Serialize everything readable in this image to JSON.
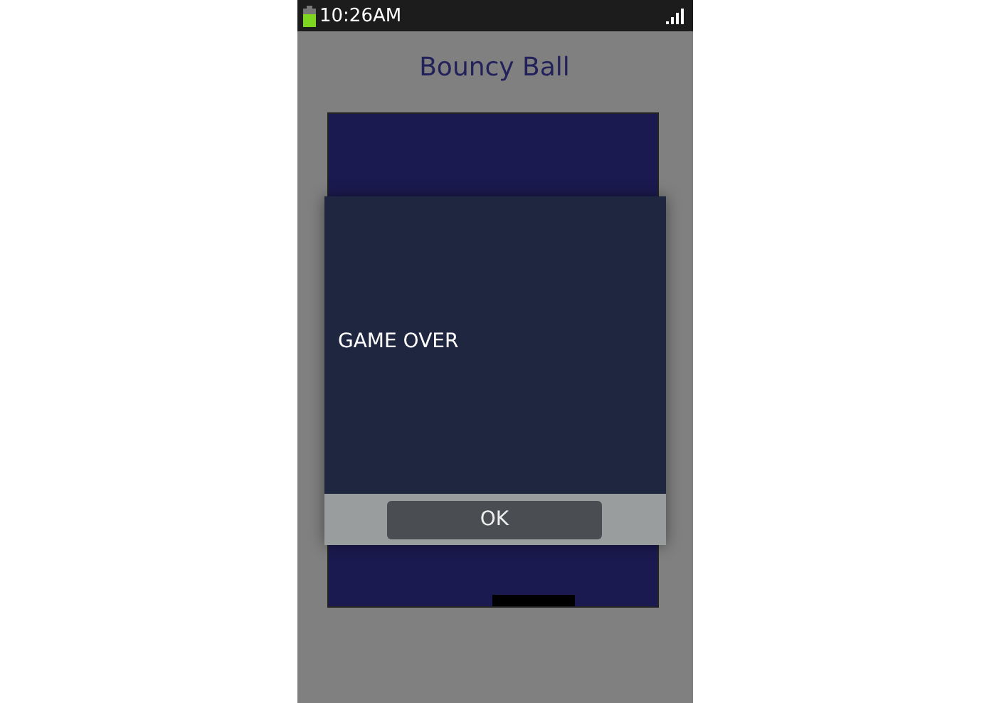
{
  "status_bar": {
    "time": "10:26AM"
  },
  "app": {
    "title": "Bouncy Ball"
  },
  "dialog": {
    "message": "GAME OVER",
    "buttons": [
      "OK"
    ]
  }
}
